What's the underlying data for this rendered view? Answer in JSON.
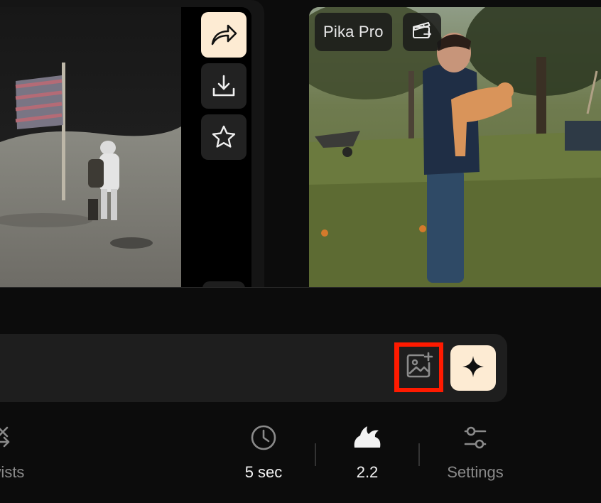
{
  "left_card": {
    "actions": [
      {
        "icon": "share-arrow-icon"
      },
      {
        "icon": "download-icon"
      },
      {
        "icon": "star-icon"
      }
    ]
  },
  "right_card": {
    "model_badge": "Pika Pro",
    "clip_icon": "clapperboard-icon"
  },
  "prompt": {
    "value": "",
    "placeholder": "",
    "image_upload_icon": "image-add-icon",
    "generate_icon": "sparkle-icon",
    "highlight_color": "#ff1a00"
  },
  "options": {
    "twists_label": "wists",
    "duration_label": "5 sec",
    "model_label": "2.2",
    "settings_label": "Settings"
  },
  "colors": {
    "accent": "#fdebd3",
    "background": "#0c0c0c",
    "panel": "#1e1e1e"
  }
}
